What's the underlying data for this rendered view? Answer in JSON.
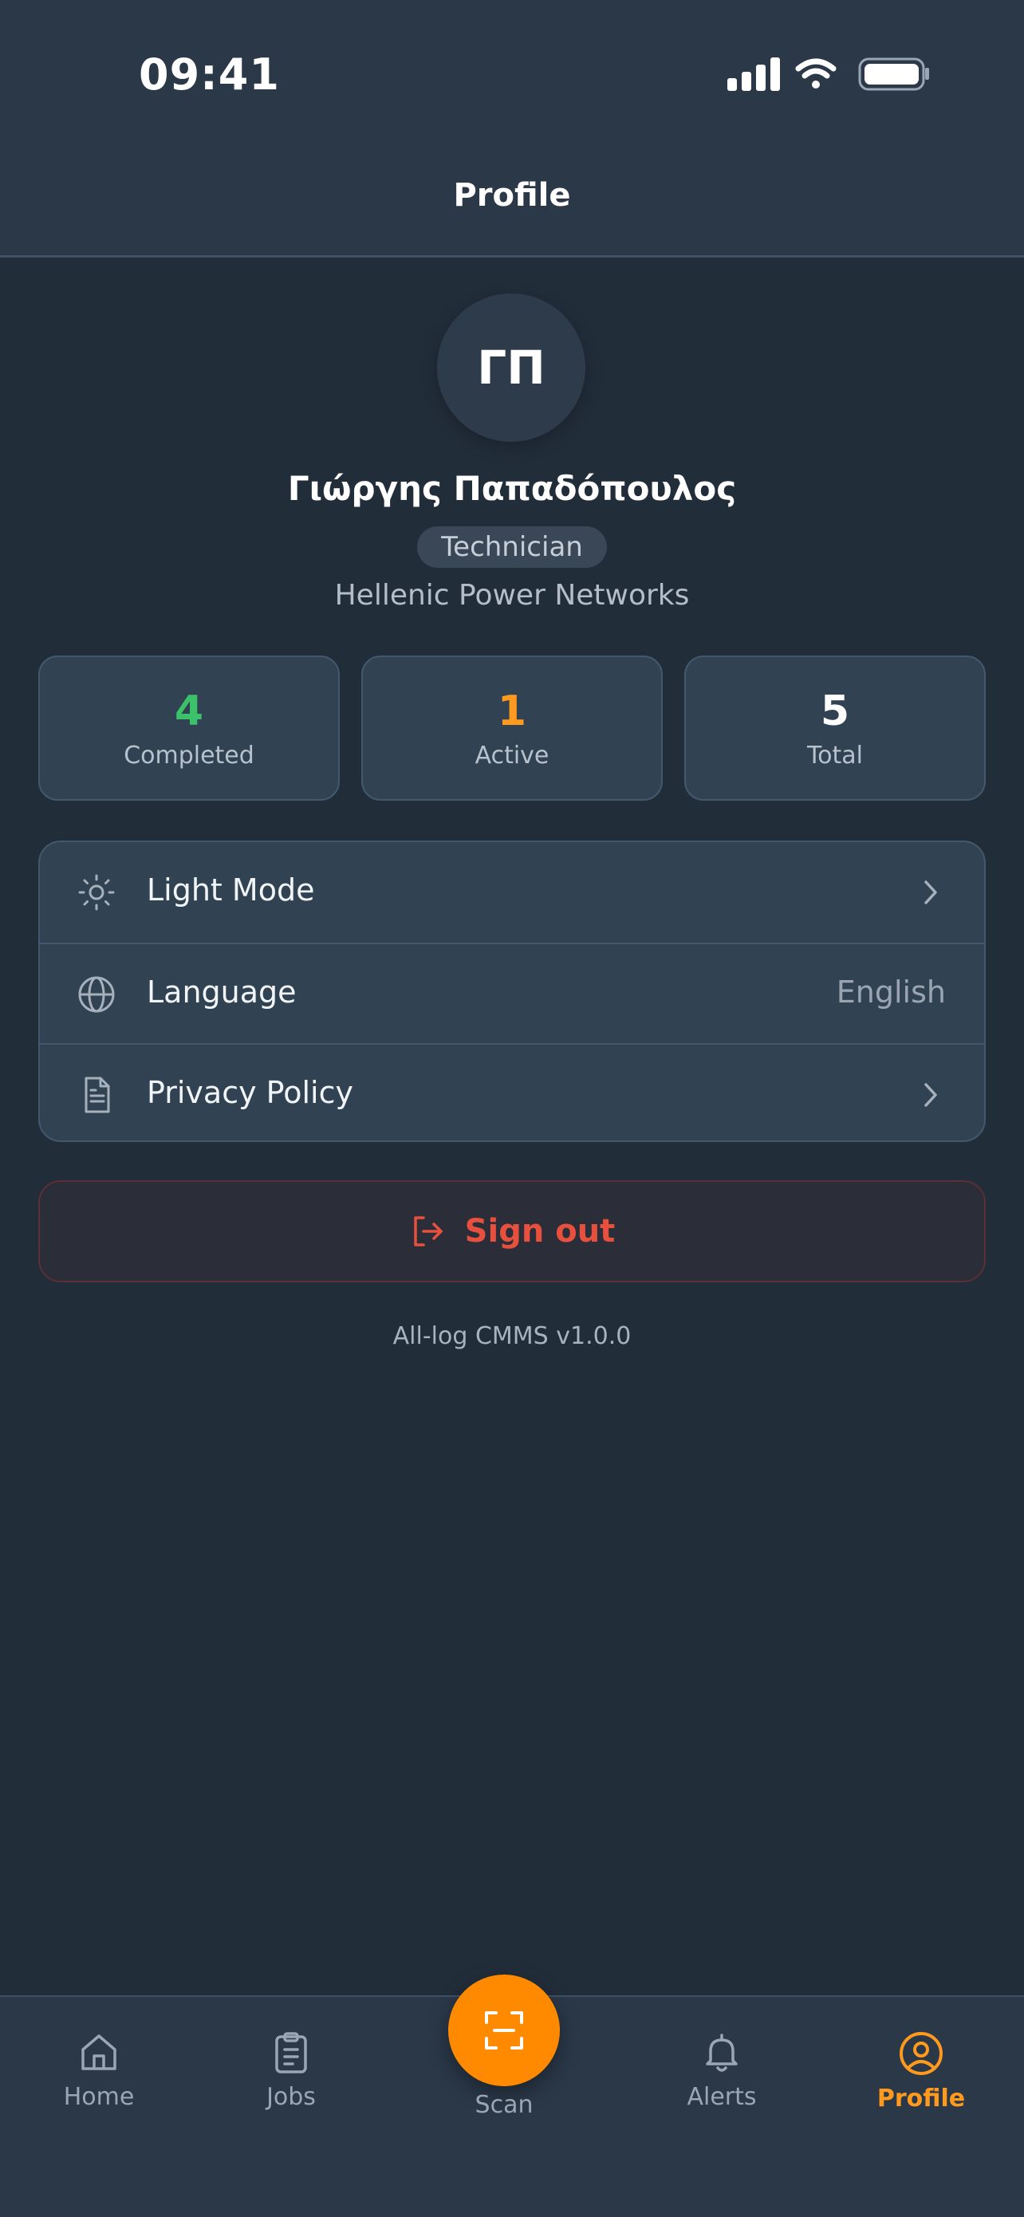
{
  "status_bar": {
    "time": "09:41"
  },
  "header": {
    "title": "Profile"
  },
  "profile": {
    "initials": "ΓΠ",
    "name": "Γιώργης Παπαδόπουλος",
    "role": "Technician",
    "company": "Hellenic Power Networks"
  },
  "stats": [
    {
      "value": "4",
      "label": "Completed",
      "color": "#3cc16b"
    },
    {
      "value": "1",
      "label": "Active",
      "color": "#ff9a1f"
    },
    {
      "value": "5",
      "label": "Total",
      "color": "#ffffff"
    }
  ],
  "settings": [
    {
      "label": "Light Mode",
      "icon": "sun-icon",
      "trailing": "chevron-right-icon"
    },
    {
      "label": "Language",
      "icon": "globe-icon",
      "value": "English"
    },
    {
      "label": "Privacy Policy",
      "icon": "document-icon",
      "trailing": "chevron-right-icon"
    }
  ],
  "sign_out": {
    "label": "Sign out",
    "icon": "logout-icon",
    "color": "#e8503e"
  },
  "version": "All-log CMMS v1.0.0",
  "bottom_nav": {
    "items": [
      {
        "label": "Home",
        "icon": "home-icon"
      },
      {
        "label": "Jobs",
        "icon": "clipboard-icon"
      },
      {
        "label": "Scan",
        "icon": "scan-icon"
      },
      {
        "label": "Alerts",
        "icon": "bell-icon"
      },
      {
        "label": "Profile",
        "icon": "user-circle-icon",
        "active": true
      }
    ],
    "accent": "#ff8a00"
  }
}
